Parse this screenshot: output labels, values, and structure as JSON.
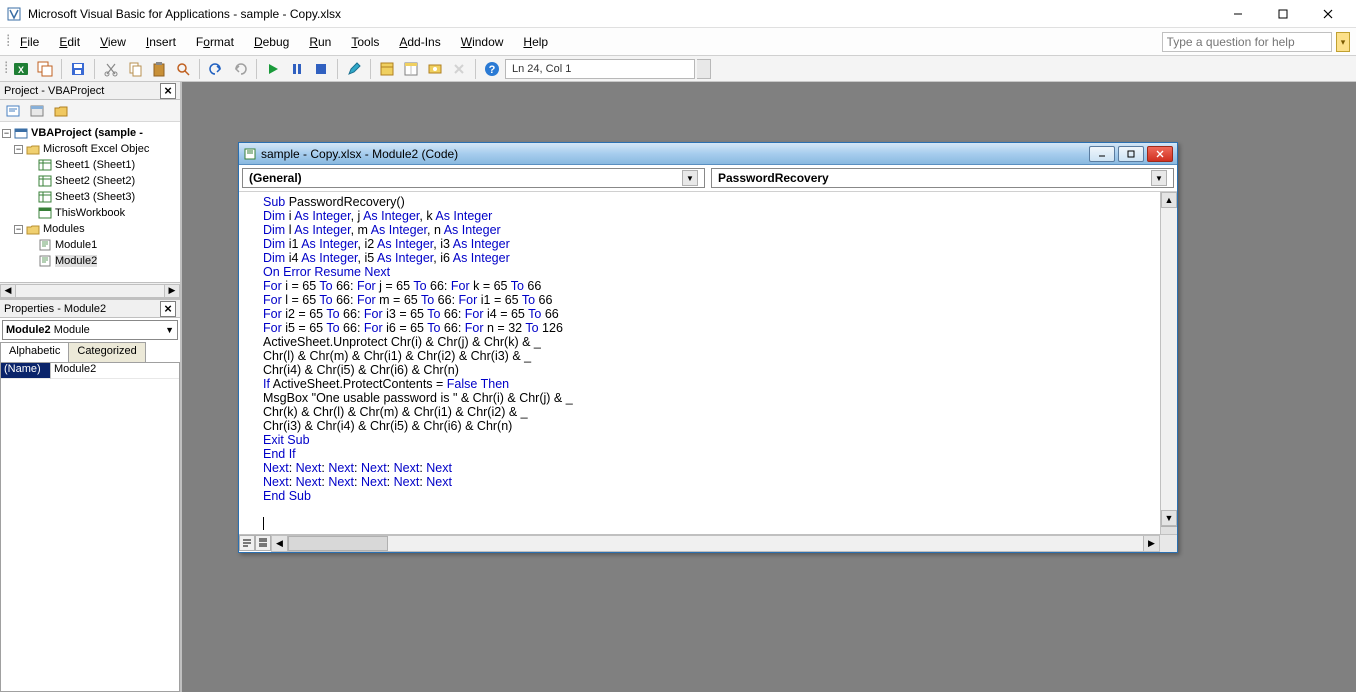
{
  "window": {
    "title": "Microsoft Visual Basic for Applications - sample -  Copy.xlsx"
  },
  "menu": {
    "file": "File",
    "edit": "Edit",
    "view": "View",
    "insert": "Insert",
    "format": "Format",
    "debug": "Debug",
    "run": "Run",
    "tools": "Tools",
    "addins": "Add-Ins",
    "window": "Window",
    "help": "Help"
  },
  "helpbox_placeholder": "Type a question for help",
  "status": {
    "linecol": "Ln 24, Col 1"
  },
  "project_panel": {
    "title": "Project - VBAProject"
  },
  "tree": {
    "root": "VBAProject (sample -",
    "excel_objects": "Microsoft Excel Objec",
    "sheet1": "Sheet1 (Sheet1)",
    "sheet2": "Sheet2 (Sheet2)",
    "sheet3": "Sheet3 (Sheet3)",
    "thiswb": "ThisWorkbook",
    "modules": "Modules",
    "module1": "Module1",
    "module2": "Module2"
  },
  "props_panel": {
    "title": "Properties - Module2"
  },
  "props_combo": {
    "name": "Module2",
    "type": "Module"
  },
  "props_tabs": {
    "alpha": "Alphabetic",
    "cat": "Categorized"
  },
  "props_row": {
    "name": "(Name)",
    "value": "Module2"
  },
  "codewin": {
    "title": "sample -  Copy.xlsx - Module2 (Code)",
    "left_combo": "(General)",
    "right_combo": "PasswordRecovery"
  },
  "code": {
    "l1a": "Sub",
    "l1b": " PasswordRecovery()",
    "l2a": "Dim",
    "l2b": " i ",
    "l2c": "As Integer",
    "l2d": ", j ",
    "l2e": "As Integer",
    "l2f": ", k ",
    "l2g": "As Integer",
    "l3a": "Dim",
    "l3b": " l ",
    "l3c": "As Integer",
    "l3d": ", m ",
    "l3e": "As Integer",
    "l3f": ", n ",
    "l3g": "As Integer",
    "l4a": "Dim",
    "l4b": " i1 ",
    "l4c": "As Integer",
    "l4d": ", i2 ",
    "l4e": "As Integer",
    "l4f": ", i3 ",
    "l4g": "As Integer",
    "l5a": "Dim",
    "l5b": " i4 ",
    "l5c": "As Integer",
    "l5d": ", i5 ",
    "l5e": "As Integer",
    "l5f": ", i6 ",
    "l5g": "As Integer",
    "l6": "On Error Resume Next",
    "l7a": "For",
    "l7b": " i = 65 ",
    "l7c": "To",
    "l7d": " 66: ",
    "l7e": "For",
    "l7f": " j = 65 ",
    "l7g": "To",
    "l7h": " 66: ",
    "l7i": "For",
    "l7j": " k = 65 ",
    "l7k": "To",
    "l7l": " 66",
    "l8a": "For",
    "l8b": " l = 65 ",
    "l8c": "To",
    "l8d": " 66: ",
    "l8e": "For",
    "l8f": " m = 65 ",
    "l8g": "To",
    "l8h": " 66: ",
    "l8i": "For",
    "l8j": " i1 = 65 ",
    "l8k": "To",
    "l8l": " 66",
    "l9a": "For",
    "l9b": " i2 = 65 ",
    "l9c": "To",
    "l9d": " 66: ",
    "l9e": "For",
    "l9f": " i3 = 65 ",
    "l9g": "To",
    "l9h": " 66: ",
    "l9i": "For",
    "l9j": " i4 = 65 ",
    "l9k": "To",
    "l9l": " 66",
    "l10a": "For",
    "l10b": " i5 = 65 ",
    "l10c": "To",
    "l10d": " 66: ",
    "l10e": "For",
    "l10f": " i6 = 65 ",
    "l10g": "To",
    "l10h": " 66: ",
    "l10i": "For",
    "l10j": " n = 32 ",
    "l10k": "To",
    "l10l": " 126",
    "l11": "ActiveSheet.Unprotect Chr(i) & Chr(j) & Chr(k) & _",
    "l12": "Chr(l) & Chr(m) & Chr(i1) & Chr(i2) & Chr(i3) & _",
    "l13": "Chr(i4) & Chr(i5) & Chr(i6) & Chr(n)",
    "l14a": "If",
    "l14b": " ActiveSheet.ProtectContents = ",
    "l14c": "False Then",
    "l15": "MsgBox \"One usable password is \" & Chr(i) & Chr(j) & _",
    "l16": "Chr(k) & Chr(l) & Chr(m) & Chr(i1) & Chr(i2) & _",
    "l17": "Chr(i3) & Chr(i4) & Chr(i5) & Chr(i6) & Chr(n)",
    "l18": "Exit Sub",
    "l19": "End If",
    "l20a": "Next",
    "l20b": ": ",
    "l20c": "Next",
    "l20d": ": ",
    "l20e": "Next",
    "l20f": ": ",
    "l20g": "Next",
    "l20h": ": ",
    "l20i": "Next",
    "l20j": ": ",
    "l20k": "Next",
    "l21a": "Next",
    "l21b": ": ",
    "l21c": "Next",
    "l21d": ": ",
    "l21e": "Next",
    "l21f": ": ",
    "l21g": "Next",
    "l21h": ": ",
    "l21i": "Next",
    "l21j": ": ",
    "l21k": "Next",
    "l22": "End Sub"
  }
}
